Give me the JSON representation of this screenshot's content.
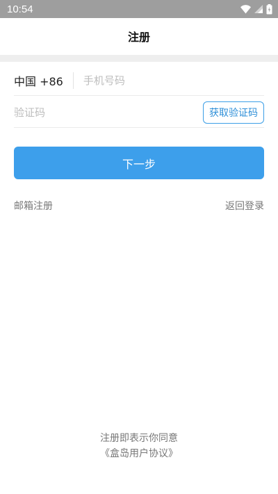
{
  "status_bar": {
    "time": "10:54",
    "icons": [
      "wifi-icon",
      "signal-icon",
      "battery-icon"
    ]
  },
  "header": {
    "title": "注册"
  },
  "form": {
    "country_code": "中国 +86",
    "phone_placeholder": "手机号码",
    "phone_value": "",
    "code_placeholder": "验证码",
    "code_value": "",
    "get_code_label": "获取验证码",
    "next_label": "下一步"
  },
  "links": {
    "email_register": "邮箱注册",
    "back_to_login": "返回登录"
  },
  "footer": {
    "consent_text": "注册即表示你同意",
    "agreement_link": "《盒岛用户协议》"
  },
  "colors": {
    "accent": "#3d9feb",
    "status_bar": "#9e9e9e",
    "muted_text": "#777777",
    "placeholder": "#bdbdbd"
  }
}
